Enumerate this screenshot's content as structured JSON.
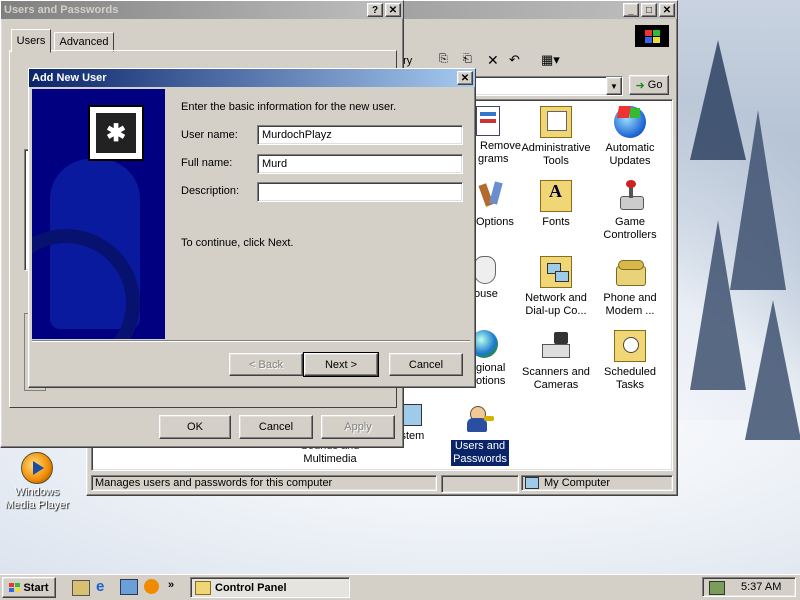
{
  "desktop": {
    "icons": [
      {
        "label_line1": "Windows",
        "label_line2": "Media Player",
        "icon": "media-player-icon"
      }
    ]
  },
  "control_panel": {
    "title": "Control Panel",
    "toolbar": {
      "history_fragment": "ory",
      "go_label": "Go"
    },
    "items": [
      {
        "line1": "Remove",
        "line2": "grams",
        "icon": "add-remove-programs-icon"
      },
      {
        "line1": "Administrative",
        "line2": "Tools",
        "icon": "administrative-tools-icon"
      },
      {
        "line1": "Automatic",
        "line2": "Updates",
        "icon": "automatic-updates-icon"
      },
      {
        "line1": "Options",
        "line2": "",
        "icon": "folder-options-icon"
      },
      {
        "line1": "Fonts",
        "line2": "",
        "icon": "fonts-icon"
      },
      {
        "line1": "Game",
        "line2": "Controllers",
        "icon": "game-controllers-icon"
      },
      {
        "line1": "ouse",
        "line2": "",
        "icon": "mouse-icon"
      },
      {
        "line1": "Network and",
        "line2": "Dial-up Co...",
        "icon": "network-icon"
      },
      {
        "line1": "Phone and",
        "line2": "Modem ...",
        "icon": "phone-modem-icon"
      },
      {
        "line1": "gional",
        "line2": "otions",
        "icon": "regional-options-icon"
      },
      {
        "line1": "Scanners and",
        "line2": "Cameras",
        "icon": "scanners-cameras-icon"
      },
      {
        "line1": "Scheduled",
        "line2": "Tasks",
        "icon": "scheduled-tasks-icon"
      },
      {
        "line1": "Sounds and",
        "line2": "Multimedia",
        "icon": "sounds-icon"
      },
      {
        "line1": "System",
        "line2": "",
        "icon": "system-icon"
      },
      {
        "line1": "Users and",
        "line2": "Passwords",
        "icon": "users-passwords-icon"
      }
    ],
    "status": {
      "text": "Manages users and passwords for this computer",
      "zone": "My Computer"
    }
  },
  "users_passwords": {
    "title": "Users and Passwords",
    "tabs": [
      "Users",
      "Advanced"
    ],
    "buttons": {
      "ok": "OK",
      "cancel": "Cancel",
      "apply": "Apply"
    }
  },
  "add_user": {
    "title": "Add New User",
    "intro": "Enter the basic information for the new user.",
    "username_label": "User name:",
    "username_value": "MurdochPlayz",
    "fullname_label": "Full name:",
    "fullname_value": "Murd",
    "description_label": "Description:",
    "description_value": "",
    "continue_text": "To continue, click Next.",
    "buttons": {
      "back": "< Back",
      "next": "Next >",
      "cancel": "Cancel"
    }
  },
  "taskbar": {
    "start_label": "Start",
    "active_window": "Control Panel",
    "clock": "5:37 AM"
  }
}
